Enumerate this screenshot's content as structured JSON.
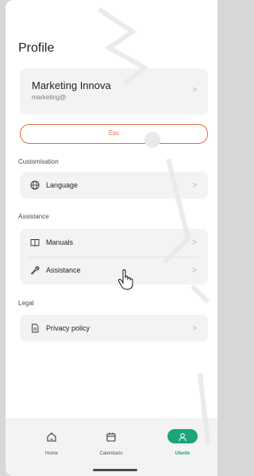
{
  "header": {
    "title": "Profile"
  },
  "account": {
    "name": "Marketing Innova",
    "email": "marketing@"
  },
  "actions": {
    "esc_label": "Esc"
  },
  "sections": {
    "customisation": {
      "title": "Customisation",
      "items": [
        {
          "label": "Language",
          "icon": "globe-icon"
        }
      ]
    },
    "assistance": {
      "title": "Assistance",
      "items": [
        {
          "label": "Manuals",
          "icon": "book-icon"
        },
        {
          "label": "Assistance",
          "icon": "wrench-icon"
        }
      ]
    },
    "legal": {
      "title": "Legal",
      "items": [
        {
          "label": "Privacy policy",
          "icon": "document-icon"
        }
      ]
    }
  },
  "bottom_nav": {
    "items": [
      {
        "label": "Home",
        "icon": "home-icon"
      },
      {
        "label": "Calendario",
        "icon": "calendar-icon"
      },
      {
        "label": "Utente",
        "icon": "user-icon",
        "active": true
      }
    ]
  },
  "colors": {
    "accent_orange": "#e86b3c",
    "active_green": "#1aa67c",
    "card_bg": "#f3f3f3"
  }
}
